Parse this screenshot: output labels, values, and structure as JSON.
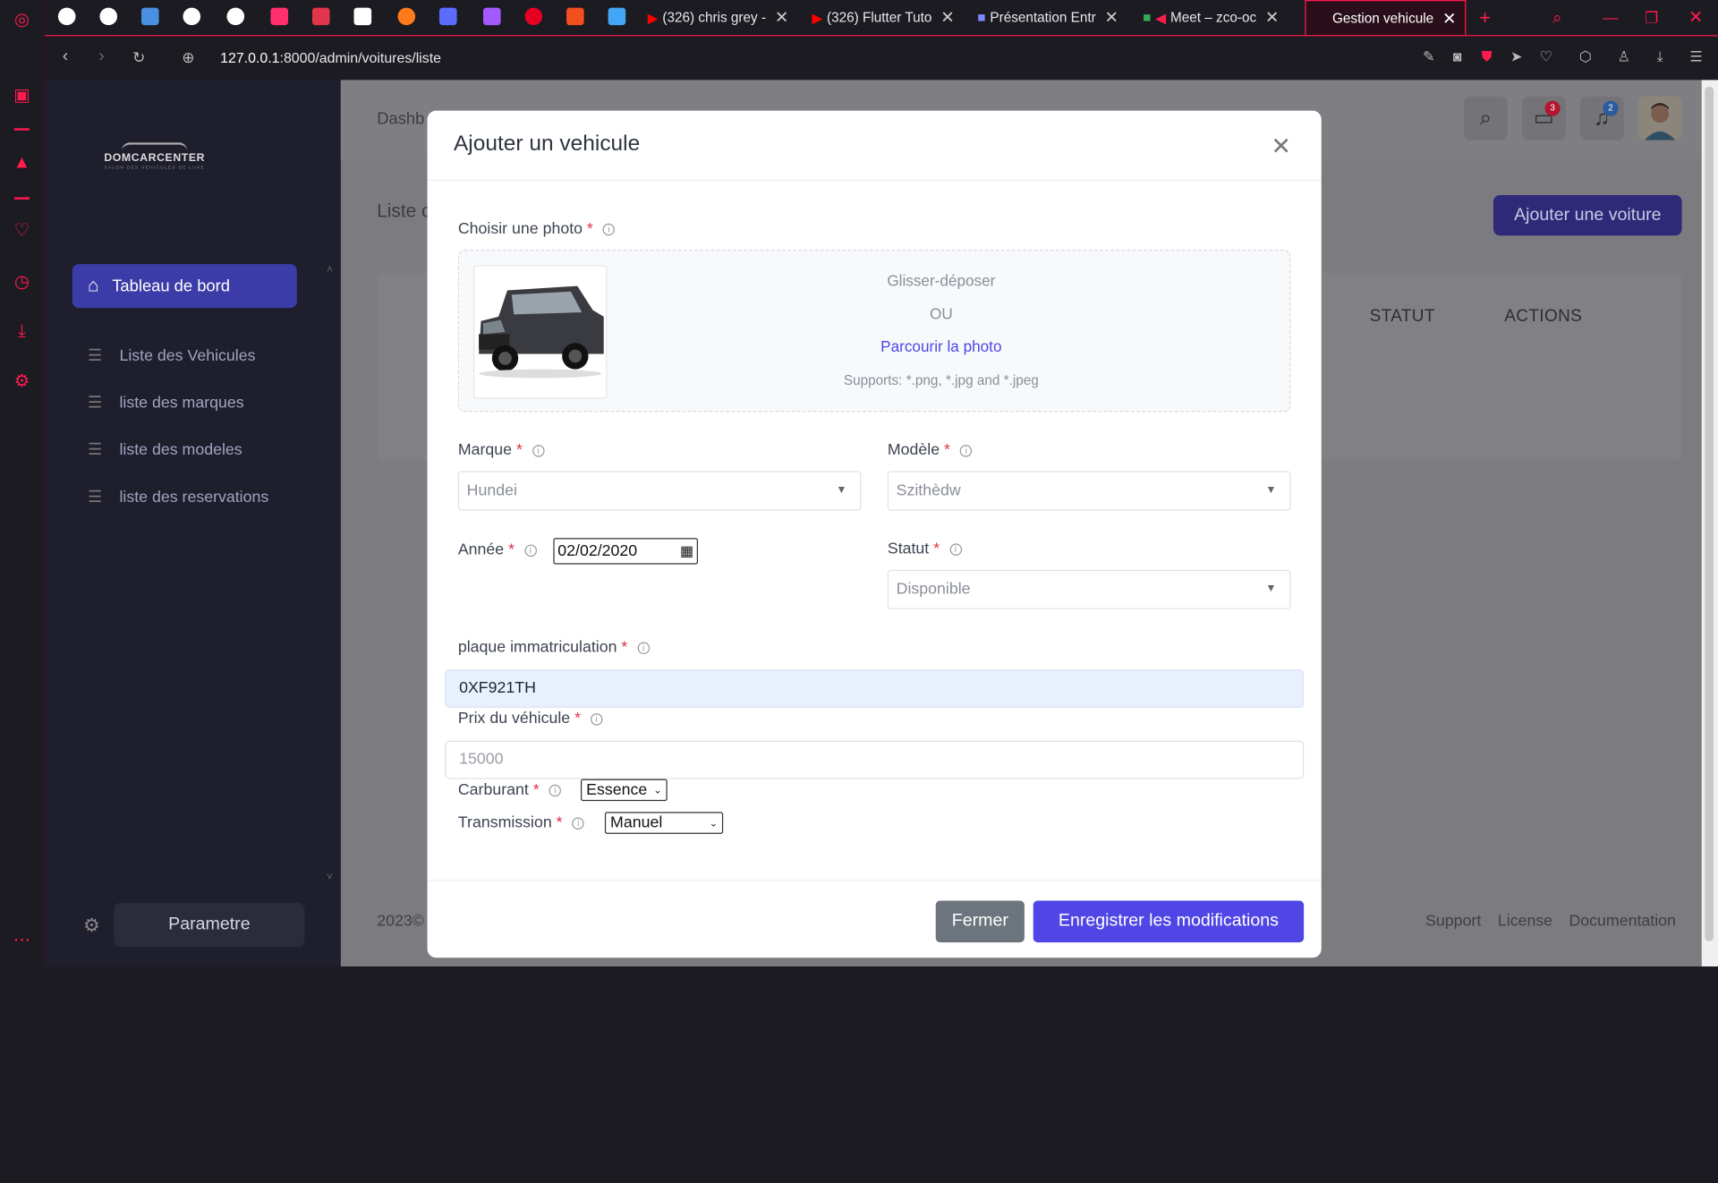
{
  "browser": {
    "tabs": [
      {
        "title": "(326) chris grey - "
      },
      {
        "title": "(326) Flutter Tuto"
      },
      {
        "title": "Présentation Entr"
      },
      {
        "title": "Meet – zco-oc"
      },
      {
        "title": "Gestion vehicule"
      }
    ],
    "url_host": "127.0.0.1",
    "url_path": ":8000/admin/voitures/liste",
    "accent": "#ff1b4d"
  },
  "sidebar": {
    "logo_text": "DOMCARCENTER",
    "logo_sub": "SALON DES VEHICULES DE LUXE",
    "active_item": "Tableau de bord",
    "items": [
      "Liste des Vehicules",
      "liste des marques",
      "liste des modeles",
      "liste des reservations"
    ],
    "settings_label": "Parametre"
  },
  "page": {
    "breadcrumb": "Dashb",
    "title": "Liste c",
    "add_button": "Ajouter une voiture",
    "table_headers": [
      "STATUT",
      "ACTIONS"
    ],
    "messages_badge": "3",
    "notif_badge": "2",
    "footer_left": "2023©",
    "footer_links": [
      "Support",
      "License",
      "Documentation"
    ]
  },
  "modal": {
    "title": "Ajouter un vehicule",
    "photo": {
      "label": "Choisir une photo",
      "drag": "Glisser-déposer",
      "or": "OU",
      "browse": "Parcourir la photo",
      "supports": "Supports: *.png, *.jpg and *.jpeg"
    },
    "marque": {
      "label": "Marque",
      "value": "Hundei"
    },
    "modele": {
      "label": "Modèle",
      "value": "Szithèdw"
    },
    "annee": {
      "label": "Année",
      "value": "02/02/2020"
    },
    "statut": {
      "label": "Statut",
      "value": "Disponible"
    },
    "plaque": {
      "label": "plaque immatriculation",
      "value": "0XF921TH"
    },
    "prix": {
      "label": "Prix du véhicule",
      "placeholder": "15000"
    },
    "carburant": {
      "label": "Carburant",
      "value": "Essence"
    },
    "transmission": {
      "label": "Transmission",
      "value": "Manuel"
    },
    "close_button": "Fermer",
    "save_button": "Enregistrer les modifications"
  }
}
